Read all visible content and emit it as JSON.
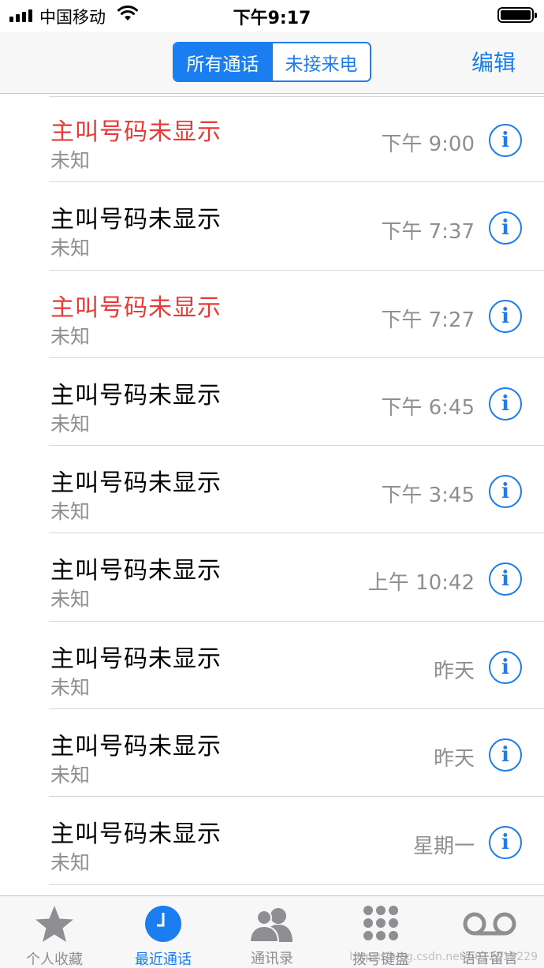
{
  "status_bar": {
    "carrier": "中国移动",
    "time": "下午9:17"
  },
  "nav_bar": {
    "segments": [
      "所有通话",
      "未接来电"
    ],
    "edit_label": "编辑"
  },
  "calls": [
    {
      "caller": "主叫号码未显示",
      "type": "未知",
      "time": "下午 9:00",
      "missed": true
    },
    {
      "caller": "主叫号码未显示",
      "type": "未知",
      "time": "下午 7:37",
      "missed": false
    },
    {
      "caller": "主叫号码未显示",
      "type": "未知",
      "time": "下午 7:27",
      "missed": true
    },
    {
      "caller": "主叫号码未显示",
      "type": "未知",
      "time": "下午 6:45",
      "missed": false
    },
    {
      "caller": "主叫号码未显示",
      "type": "未知",
      "time": "下午 3:45",
      "missed": false
    },
    {
      "caller": "主叫号码未显示",
      "type": "未知",
      "time": "上午 10:42",
      "missed": false
    },
    {
      "caller": "主叫号码未显示",
      "type": "未知",
      "time": "昨天",
      "missed": false
    },
    {
      "caller": "主叫号码未显示",
      "type": "未知",
      "time": "昨天",
      "missed": false
    },
    {
      "caller": "主叫号码未显示",
      "type": "未知",
      "time": "星期一",
      "missed": false
    }
  ],
  "info_icon": "i",
  "tab_bar": {
    "tabs": [
      {
        "label": "个人收藏",
        "icon": "star-icon"
      },
      {
        "label": "最近通话",
        "icon": "clock-icon",
        "active": true
      },
      {
        "label": "通讯录",
        "icon": "contacts-icon"
      },
      {
        "label": "拨号键盘",
        "icon": "keypad-icon"
      },
      {
        "label": "语音留言",
        "icon": "voicemail-icon"
      }
    ]
  },
  "colors": {
    "accent": "#1a7df0",
    "missed": "#e53a36",
    "secondary": "#8e8e93"
  },
  "watermark": "https://blog.csdn.net/u012019229"
}
